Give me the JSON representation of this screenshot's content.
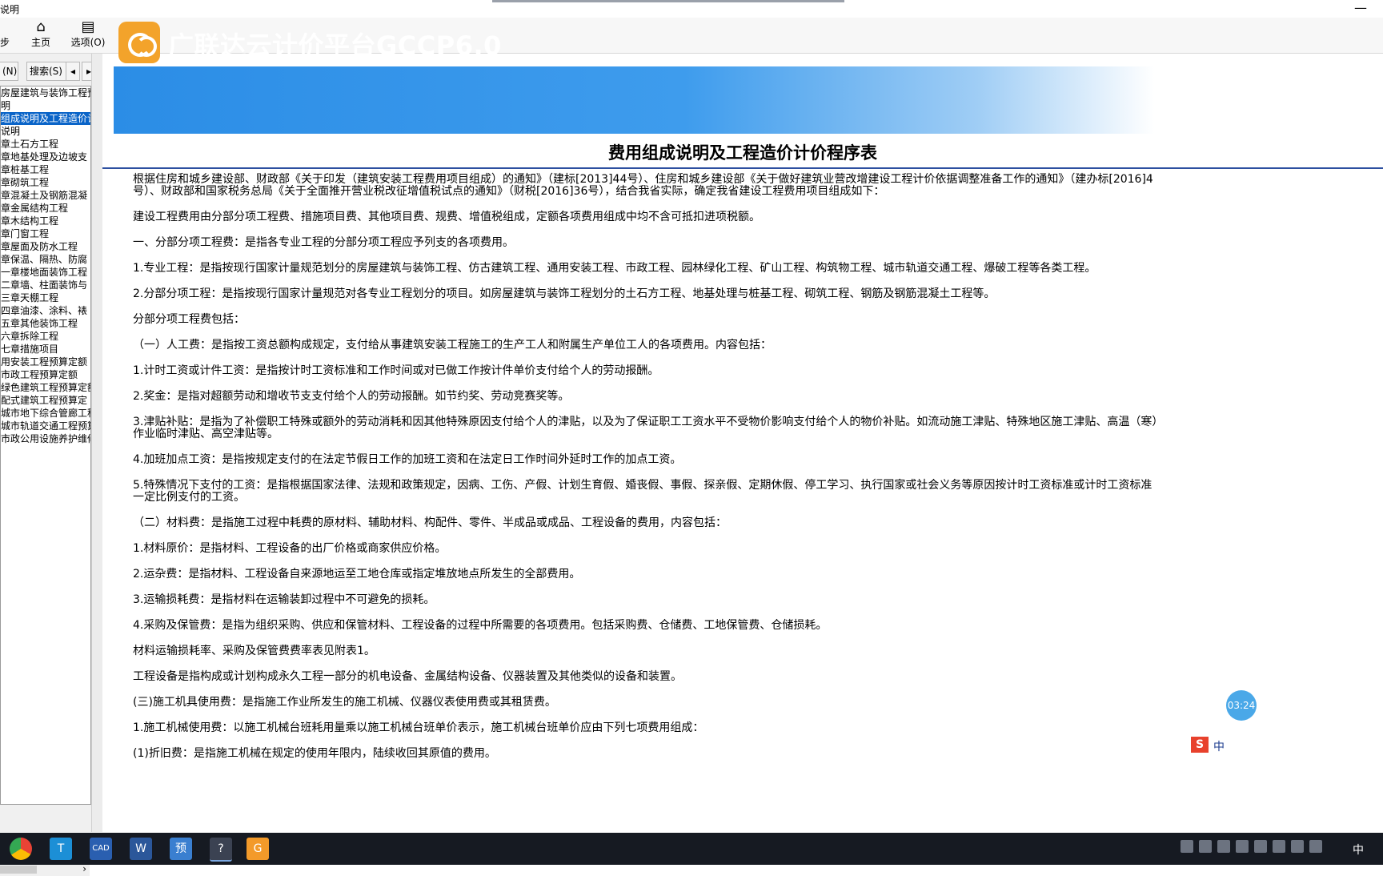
{
  "window": {
    "title": "说明",
    "minimize_glyph": "—"
  },
  "toolbar": {
    "sync_label": "步",
    "home_label": "主页",
    "options_label": "选项(O)"
  },
  "left_tabs": {
    "index_label": "(N)",
    "search_label": "搜索(S)"
  },
  "tree_items": [
    "房屋建筑与装饰工程预",
    "明",
    "组成说明及工程造价计",
    "说明",
    "章土石方工程",
    "章地基处理及边坡支",
    "章桩基工程",
    "章砌筑工程",
    "章混凝土及钢筋混凝",
    "章金属结构工程",
    "章木结构工程",
    "章门窗工程",
    "章屋面及防水工程",
    "章保温、隔热、防腐",
    "一章楼地面装饰工程",
    "二章墙、柱面装饰与",
    "三章天棚工程",
    "四章油漆、涂料、裱",
    "五章其他装饰工程",
    "六章拆除工程",
    "七章措施项目",
    "用安装工程预算定额",
    "市政工程预算定额",
    "绿色建筑工程预算定额",
    "配式建筑工程预算定",
    "城市地下综合管廊工程",
    "城市轨道交通工程预算",
    "市政公用设施养护维修"
  ],
  "selected_tree_index": 2,
  "banner": {
    "title": "广联达云计价平台GCCP6.0"
  },
  "document": {
    "title": "费用组成说明及工程造价计价程序表",
    "paragraphs": [
      [
        "根据住房和城乡建设部、财政部《关于印发（建筑安装工程费用项目组成）的通知》（建标[2013]44号）、住房和城乡建设部《关于做好建筑业营改增建设工程计价依据调整准备工作的通知》（建办标[2016]4",
        "号）、财政部和国家税务总局《关于全面推开营业税改征增值税试点的通知》（财税[2016]36号），结合我省实际，确定我省建设工程费用项目组成如下："
      ],
      [
        "建设工程费用由分部分项工程费、措施项目费、其他项目费、规费、增值税组成，定额各项费用组成中均不含可抵扣进项税额。"
      ],
      [
        "一、分部分项工程费：是指各专业工程的分部分项工程应予列支的各项费用。"
      ],
      [
        "1.专业工程：是指按现行国家计量规范划分的房屋建筑与装饰工程、仿古建筑工程、通用安装工程、市政工程、园林绿化工程、矿山工程、构筑物工程、城市轨道交通工程、爆破工程等各类工程。"
      ],
      [
        "2.分部分项工程：是指按现行国家计量规范对各专业工程划分的项目。如房屋建筑与装饰工程划分的土石方工程、地基处理与桩基工程、砌筑工程、钢筋及钢筋混凝土工程等。"
      ],
      [
        "分部分项工程费包括："
      ],
      [
        "（一）人工费：是指按工资总额构成规定，支付给从事建筑安装工程施工的生产工人和附属生产单位工人的各项费用。内容包括："
      ],
      [
        "1.计时工资或计件工资：是指按计时工资标准和工作时间或对已做工作按计件单价支付给个人的劳动报酬。"
      ],
      [
        "2.奖金：是指对超额劳动和增收节支支付给个人的劳动报酬。如节约奖、劳动竞赛奖等。"
      ],
      [
        "3.津贴补贴：是指为了补偿职工特殊或额外的劳动消耗和因其他特殊原因支付给个人的津贴，以及为了保证职工工资水平不受物价影响支付给个人的物价补贴。如流动施工津贴、特殊地区施工津贴、高温（寒）",
        "作业临时津贴、高空津贴等。"
      ],
      [
        "4.加班加点工资：是指按规定支付的在法定节假日工作的加班工资和在法定日工作时间外延时工作的加点工资。"
      ],
      [
        "5.特殊情况下支付的工资：是指根据国家法律、法规和政策规定，因病、工伤、产假、计划生育假、婚丧假、事假、探亲假、定期休假、停工学习、执行国家或社会义务等原因按计时工资标准或计时工资标准",
        "一定比例支付的工资。"
      ],
      [
        "（二）材料费：是指施工过程中耗费的原材料、辅助材料、构配件、零件、半成品或成品、工程设备的费用，内容包括："
      ],
      [
        "1.材料原价：是指材料、工程设备的出厂价格或商家供应价格。"
      ],
      [
        "2.运杂费：是指材料、工程设备自来源地运至工地仓库或指定堆放地点所发生的全部费用。"
      ],
      [
        "3.运输损耗费：是指材料在运输装卸过程中不可避免的损耗。"
      ],
      [
        "4.采购及保管费：是指为组织采购、供应和保管材料、工程设备的过程中所需要的各项费用。包括采购费、仓储费、工地保管费、仓储损耗。"
      ],
      [
        "材料运输损耗率、采购及保管费费率表见附表1。"
      ],
      [
        "工程设备是指构成或计划构成永久工程一部分的机电设备、金属结构设备、仪器装置及其他类似的设备和装置。"
      ],
      [
        "(三)施工机具使用费：是指施工作业所发生的施工机械、仪器仪表使用费或其租赁费。"
      ],
      [
        "1.施工机械使用费：以施工机械台班耗用量乘以施工机械台班单价表示，施工机械台班单价应由下列七项费用组成："
      ],
      [
        "(1)折旧费：是指施工机械在规定的使用年限内，陆续收回其原值的费用。"
      ]
    ]
  },
  "overlay": {
    "timer": "03:24",
    "ime_text": "中"
  },
  "taskbar": {
    "apps": [
      "chrome-icon",
      "t-app-icon",
      "cad-icon",
      "word-icon",
      "yu-app-icon",
      "help-app-icon",
      "g-app-icon"
    ],
    "ime": "中"
  },
  "colors": {
    "banner_blue": "#2b8de6",
    "selection": "#0a64c8",
    "logo_orange": "#f3a32b",
    "taskbar": "#161a22"
  }
}
